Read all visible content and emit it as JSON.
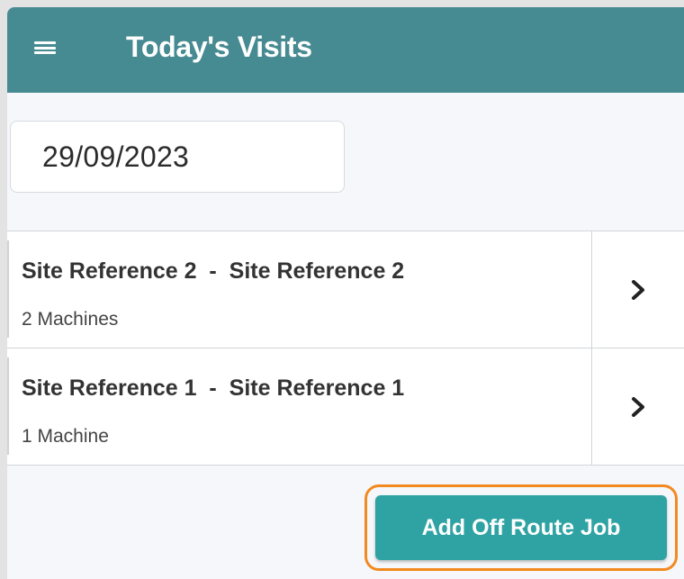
{
  "header": {
    "title": "Today's Visits",
    "menu_icon": "hamburger-menu-icon",
    "background": "#478b92"
  },
  "date_field": {
    "value": "29/09/2023"
  },
  "visits": [
    {
      "title": "Site Reference 2  -  Site Reference 2",
      "subtitle": "2 Machines"
    },
    {
      "title": "Site Reference 1  -  Site Reference 1",
      "subtitle": "1 Machine"
    }
  ],
  "actions": {
    "add_off_route_label": "Add Off Route Job",
    "button_color": "#2fa3a3",
    "highlight_color": "#f28a1f"
  }
}
